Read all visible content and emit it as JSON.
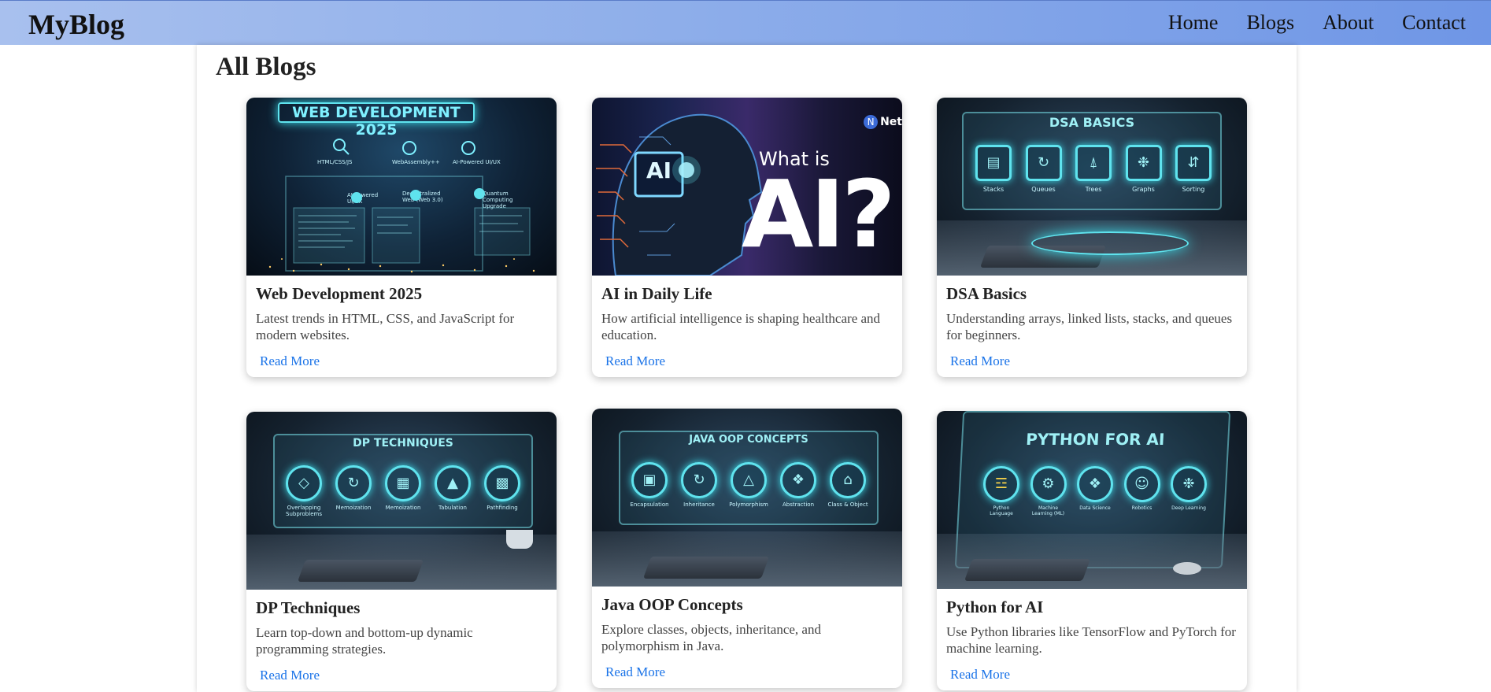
{
  "nav": {
    "brand": "MyBlog",
    "links": [
      "Home",
      "Blogs",
      "About",
      "Contact"
    ]
  },
  "page": {
    "title": "All Blogs"
  },
  "cards": [
    {
      "title": "Web Development 2025",
      "description": "Latest trends in HTML, CSS, and JavaScript for modern websites.",
      "link": "Read More",
      "image_heading": "WEB DEVELOPMENT 2025",
      "image_icons": [
        "HTML/CSS/JS",
        "WebAssembly++",
        "AI-Powered UI/UX",
        "AI-Powered UI/UX",
        "Decentralized Web (Web 3.0)",
        "Quantum Computing Upgrade"
      ]
    },
    {
      "title": "AI in Daily Life",
      "description": "How artificial intelligence is shaping healthcare and education.",
      "link": "Read More",
      "image_badge": "AI",
      "image_text_small": "What is",
      "image_text_large": "AI?",
      "image_logo": "Net"
    },
    {
      "title": "DSA Basics",
      "description": "Understanding arrays, linked lists, stacks, and queues for beginners.",
      "link": "Read More",
      "image_heading": "DSA BASICS",
      "image_icons": [
        "Stacks",
        "Queues",
        "Trees",
        "Graphs",
        "Sorting"
      ]
    },
    {
      "title": "DP Techniques",
      "description": "Learn top-down and bottom-up dynamic programming strategies.",
      "link": "Read More",
      "image_heading": "DP TECHNIQUES",
      "image_icons": [
        "Overlapping Subproblems",
        "Memoization",
        "Memoization",
        "Tabulation",
        "Pathfinding"
      ]
    },
    {
      "title": "Java OOP Concepts",
      "description": "Explore classes, objects, inheritance, and polymorphism in Java.",
      "link": "Read More",
      "image_heading": "JAVA OOP CONCEPTS",
      "image_icons": [
        "Encapsulation",
        "Inheritance",
        "Polymorphism",
        "Abstraction",
        "Class & Object"
      ]
    },
    {
      "title": "Python for AI",
      "description": "Use Python libraries like TensorFlow and PyTorch for machine learning.",
      "link": "Read More",
      "image_heading": "PYTHON FOR AI",
      "image_icons": [
        "Python Language",
        "Machine Learning (ML)",
        "Data Science",
        "Robotics",
        "Deep Learning"
      ]
    }
  ],
  "colors": {
    "nav_gradient_start": "#a8c0ee",
    "nav_gradient_end": "#6f96e6",
    "link": "#1a73e8",
    "neon": "#5fe3ee"
  }
}
